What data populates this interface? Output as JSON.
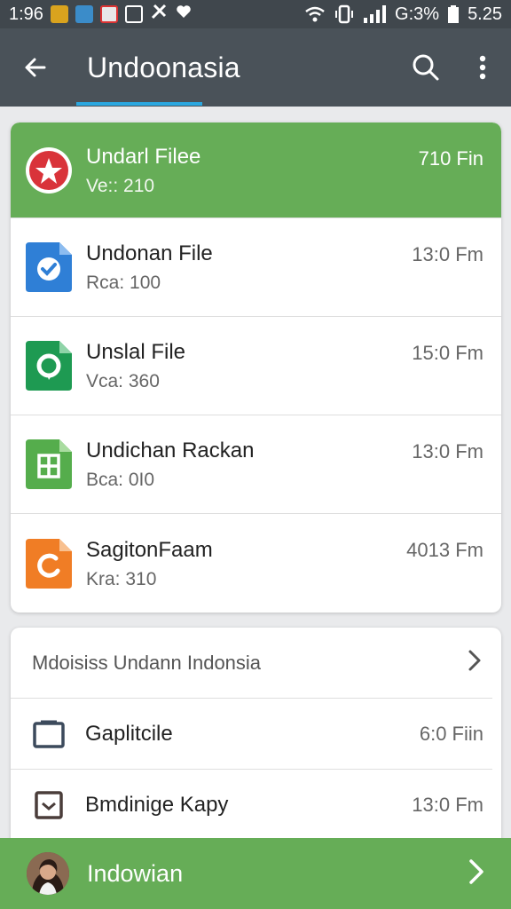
{
  "status_bar": {
    "time": "1:96",
    "battery_text": "G:3%",
    "clock": "5.25"
  },
  "toolbar": {
    "title": "Undoonasia",
    "back_icon": "arrow-left-icon",
    "search_icon": "search-icon",
    "more_icon": "more-vert-icon"
  },
  "files": [
    {
      "name": "Undarl Filee",
      "meta": "Ve:: 210",
      "time": "710 Fin",
      "icon": "star-circle-icon",
      "highlighted": true
    },
    {
      "name": "Undonan File",
      "meta": "Rca: 100",
      "time": "13:0 Fm",
      "icon": "check-file-icon"
    },
    {
      "name": "Unslal File",
      "meta": "Vca: 360",
      "time": "15:0 Fm",
      "icon": "chat-file-icon"
    },
    {
      "name": "Undichan Rackan",
      "meta": "Bca: 0I0",
      "time": "13:0 Fm",
      "icon": "sheet-file-icon"
    },
    {
      "name": "SagitonFaam",
      "meta": "Kra: 310",
      "time": "4013 Fm",
      "icon": "orange-file-icon"
    }
  ],
  "section": {
    "header": "Mdoisiss Undann Indonsia",
    "items": [
      {
        "label": "Gaplitcile",
        "time": "6:0 Fiin",
        "icon": "folder-outline-icon"
      },
      {
        "label": "Bmdinige Kapy",
        "time": "13:0 Fm",
        "icon": "checkbox-icon"
      }
    ]
  },
  "bottom_bar": {
    "label": "Indowian",
    "color": "#66ad57"
  },
  "colors": {
    "accent_green": "#66ad57",
    "toolbar": "#4a5259",
    "tab_indicator": "#2aa7df"
  }
}
